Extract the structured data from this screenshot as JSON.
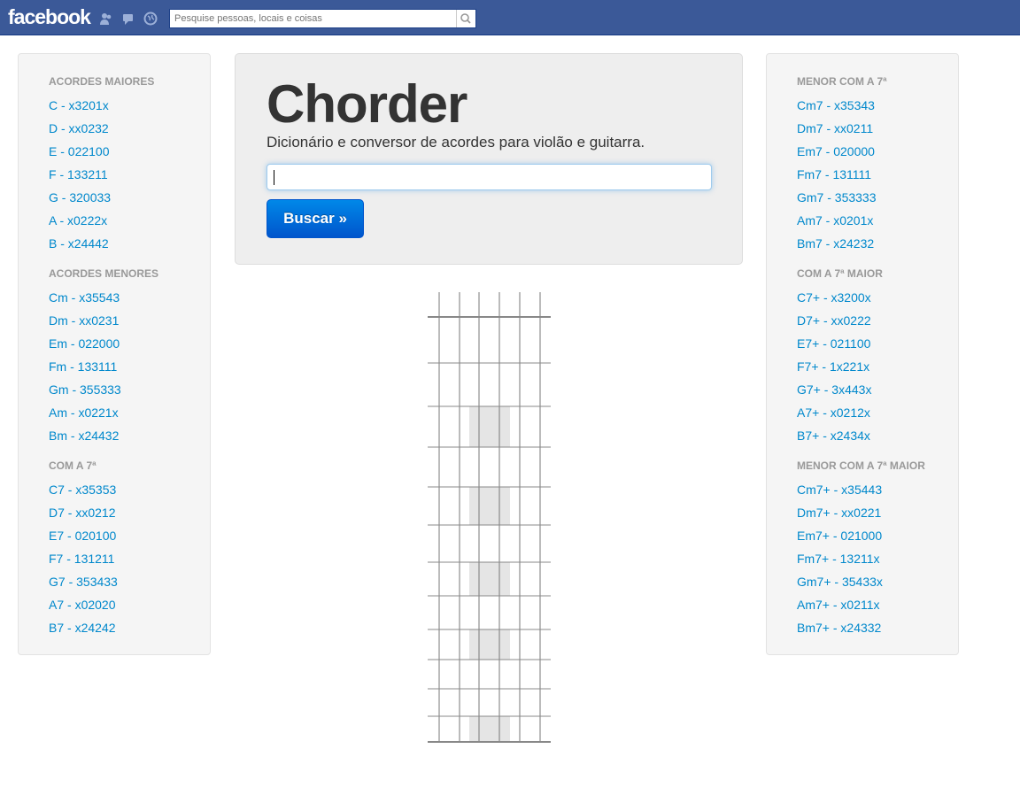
{
  "facebook": {
    "logo": "facebook",
    "search_placeholder": "Pesquise pessoas, locais e coisas"
  },
  "hero": {
    "title": "Chorder",
    "subtitle": "Dicionário e conversor de acordes para violão e guitarra.",
    "input_value": "",
    "button_label": "Buscar »"
  },
  "left_sections": [
    {
      "title": "ACORDES MAIORES",
      "items": [
        "C - x3201x",
        "D - xx0232",
        "E - 022100",
        "F - 133211",
        "G - 320033",
        "A - x0222x",
        "B - x24442"
      ]
    },
    {
      "title": "ACORDES MENORES",
      "items": [
        "Cm - x35543",
        "Dm - xx0231",
        "Em - 022000",
        "Fm - 133111",
        "Gm - 355333",
        "Am - x0221x",
        "Bm - x24432"
      ]
    },
    {
      "title": "COM A 7ª",
      "items": [
        "C7 - x35353",
        "D7 - xx0212",
        "E7 - 020100",
        "F7 - 131211",
        "G7 - 353433",
        "A7 - x02020",
        "B7 - x24242"
      ]
    }
  ],
  "right_sections": [
    {
      "title": "MENOR COM A 7ª",
      "items": [
        "Cm7 - x35343",
        "Dm7 - xx0211",
        "Em7 - 020000",
        "Fm7 - 131111",
        "Gm7 - 353333",
        "Am7 - x0201x",
        "Bm7 - x24232"
      ]
    },
    {
      "title": "COM A 7ª MAIOR",
      "items": [
        "C7+ - x3200x",
        "D7+ - xx0222",
        "E7+ - 021100",
        "F7+ - 1x221x",
        "G7+ - 3x443x",
        "A7+ - x0212x",
        "B7+ - x2434x"
      ]
    },
    {
      "title": "MENOR COM A 7ª MAIOR",
      "items": [
        "Cm7+ - x35443",
        "Dm7+ - xx0221",
        "Em7+ - 021000",
        "Fm7+ - 13211x",
        "Gm7+ - 35433x",
        "Am7+ - x0211x",
        "Bm7+ - x24332"
      ]
    }
  ],
  "colors": {
    "link": "#0088cc",
    "section_title": "#999999",
    "facebook_blue": "#3b5998",
    "fret_highlight": "#e5e5e5"
  }
}
